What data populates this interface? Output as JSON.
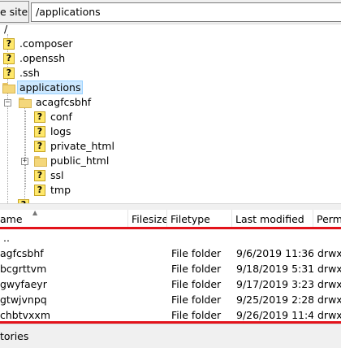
{
  "path_bar": {
    "label": "e site:",
    "value": "/applications"
  },
  "tree": {
    "root": "/",
    "items": [
      {
        "label": ".composer",
        "icon": "unknown-folder-icon"
      },
      {
        "label": ".openssh",
        "icon": "unknown-folder-icon"
      },
      {
        "label": ".ssh",
        "icon": "unknown-folder-icon"
      },
      {
        "label": "applications",
        "icon": "folder-icon",
        "selected": true
      },
      {
        "label": "acagfcsbhf",
        "icon": "folder-icon",
        "expanded": true
      },
      {
        "label": "conf",
        "icon": "unknown-folder-icon"
      },
      {
        "label": "logs",
        "icon": "unknown-folder-icon"
      },
      {
        "label": "private_html",
        "icon": "unknown-folder-icon"
      },
      {
        "label": "public_html",
        "icon": "folder-icon",
        "expandable": true
      },
      {
        "label": "ssl",
        "icon": "unknown-folder-icon"
      },
      {
        "label": "tmp",
        "icon": "unknown-folder-icon"
      }
    ]
  },
  "file_list": {
    "columns": {
      "name": "ame",
      "filesize": "Filesize",
      "filetype": "Filetype",
      "modified": "Last modified",
      "permissions": "Perm"
    },
    "parent_row": "..",
    "rows": [
      {
        "name": "agfcsbhf",
        "filesize": "",
        "filetype": "File folder",
        "modified": "9/6/2019 11:36:...",
        "permissions": "drwxr"
      },
      {
        "name": "bcgrttvm",
        "filesize": "",
        "filetype": "File folder",
        "modified": "9/18/2019 5:31:...",
        "permissions": "drwxr"
      },
      {
        "name": "gwyfaeyr",
        "filesize": "",
        "filetype": "File folder",
        "modified": "9/17/2019 3:23:...",
        "permissions": "drwxr"
      },
      {
        "name": "gtwjvnpq",
        "filesize": "",
        "filetype": "File folder",
        "modified": "9/25/2019 2:28:...",
        "permissions": "drwxr"
      },
      {
        "name": "chbtvxxm",
        "filesize": "",
        "filetype": "File folder",
        "modified": "9/26/2019 11:4...",
        "permissions": "drwxr"
      }
    ]
  },
  "status": {
    "text": "tories"
  },
  "colors": {
    "highlight_border": "#e3131b",
    "selection": "#cce8ff"
  }
}
